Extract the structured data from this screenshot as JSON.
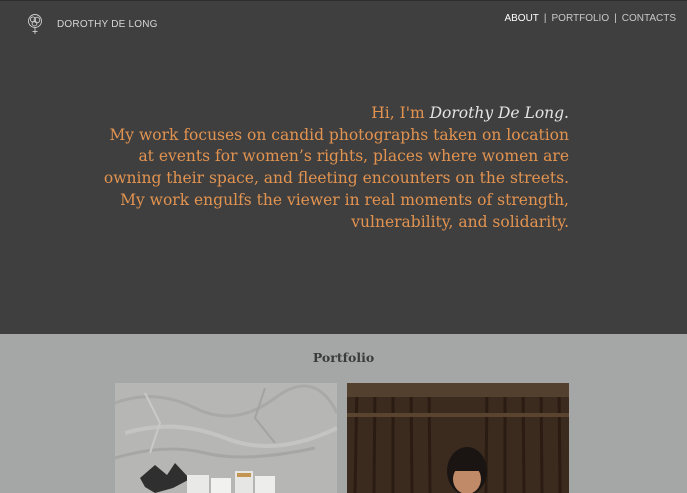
{
  "brand": {
    "name": "DOROTHY DE LONG",
    "logo_icon": "flower-logo-icon"
  },
  "nav": {
    "items": [
      {
        "label": "ABOUT",
        "active": true
      },
      {
        "label": "PORTFOLIO",
        "active": false
      },
      {
        "label": "CONTACTS",
        "active": false
      }
    ],
    "separator": "|"
  },
  "intro": {
    "greeting": "Hi, I'm",
    "name": "Dorothy De Long.",
    "lines": [
      "My work focuses on candid photographs taken on location",
      "at events for women’s rights, places where women are",
      "owning their space, and fleeting encounters on the streets.",
      "My work engulfs the viewer in real moments of strength,",
      "vulnerability, and solidarity."
    ]
  },
  "portfolio": {
    "title": "Portfolio",
    "items": [
      {
        "alt": "white plaster wall with cut-out figures"
      },
      {
        "alt": "portrait of a smiling child"
      }
    ]
  },
  "colors": {
    "hero_bg": "#3f3f3f",
    "accent": "#e29350",
    "portfolio_bg": "#a4a7a5"
  }
}
